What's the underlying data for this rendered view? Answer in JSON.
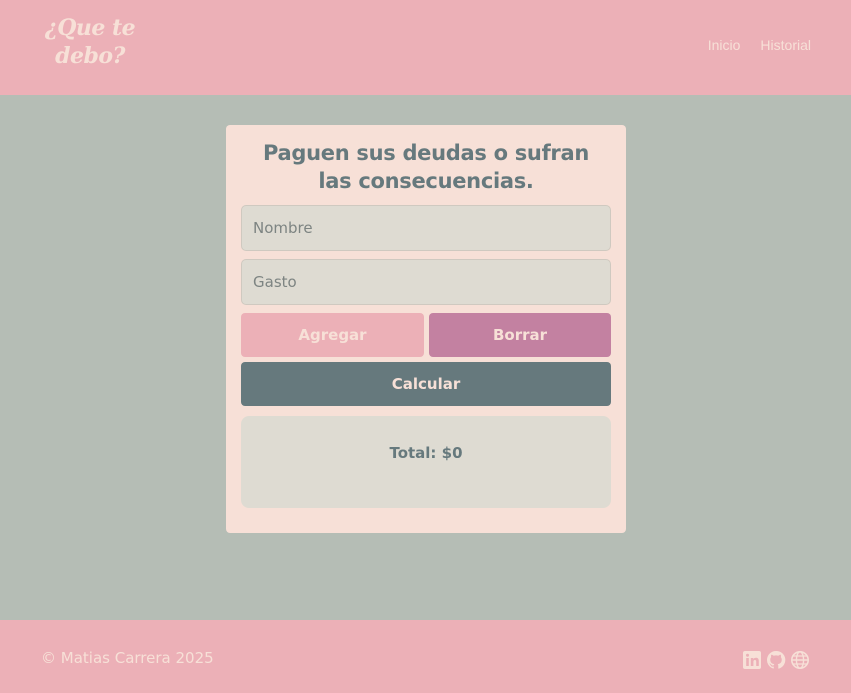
{
  "colors": {
    "background": "#b5bdb5",
    "header_footer": "#ecb0b7",
    "card": "#f7e0d7",
    "text_primary": "#66797d",
    "text_light": "#f7e0d7",
    "field_bg": "#dedbd2",
    "delete_button": "#c381a1",
    "calculate_button": "#66797d"
  },
  "header": {
    "logo_line1": "¿Que te",
    "logo_line2": "debo?",
    "nav": [
      {
        "label": "Inicio"
      },
      {
        "label": "Historial"
      }
    ]
  },
  "card": {
    "title": "Paguen sus deudas o sufran las consecuencias.",
    "name_placeholder": "Nombre",
    "expense_placeholder": "Gasto",
    "add_label": "Agregar",
    "delete_label": "Borrar",
    "calculate_label": "Calcular",
    "total_text": "Total: $0"
  },
  "footer": {
    "copyright": "© Matias Carrera 2025",
    "social_icons": [
      "linkedin-icon",
      "github-icon",
      "globe-icon"
    ]
  }
}
